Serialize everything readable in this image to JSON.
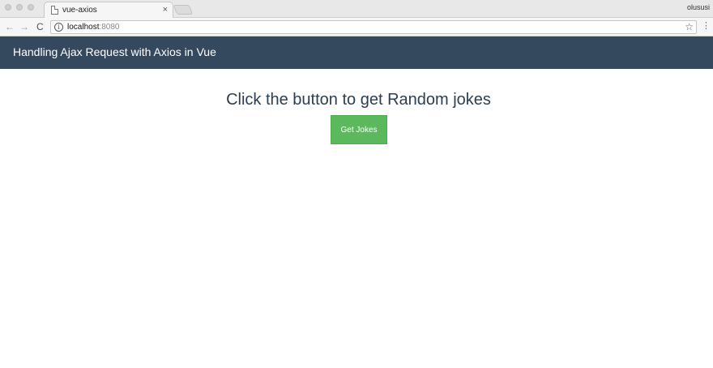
{
  "browser": {
    "tab_title": "vue-axios",
    "tab_close": "×",
    "profile_name": "olususi",
    "url_host": "localhost",
    "url_port": ":8080",
    "back_glyph": "←",
    "forward_glyph": "→",
    "reload_glyph": "C",
    "info_glyph": "i",
    "star_glyph": "☆",
    "menu_glyph": "⋮"
  },
  "navbar": {
    "title": "Handling Ajax Request with Axios in Vue",
    "background": "#35495e"
  },
  "main": {
    "heading": "Click the button to get Random jokes",
    "button_label": "Get Jokes",
    "button_color": "#5cb85c"
  }
}
